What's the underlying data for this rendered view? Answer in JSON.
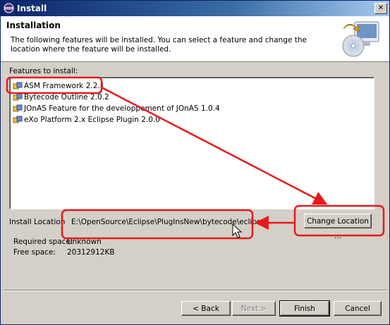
{
  "window": {
    "title": "Install"
  },
  "header": {
    "heading": "Installation",
    "description": "The following features will be installed. You can select a feature and change the location where the feature will be installed."
  },
  "features": {
    "label": "Features to install:",
    "items": [
      {
        "label": "ASM Framework 2.2.1",
        "icon": "feature-plug-icon"
      },
      {
        "label": "Bytecode Outline 2.0.2",
        "icon": "feature-plug-icon"
      },
      {
        "label": "JOnAS Feature for the developpement of JOnAS 1.0.4",
        "icon": "feature-plug-icon"
      },
      {
        "label": "eXo Platform 2.x Eclipse Plugin 2.0.0",
        "icon": "feature-plug-icon"
      }
    ]
  },
  "install_location": {
    "label": "Install Location",
    "value": "E:\\OpenSource\\Eclipse\\PlugInsNew\\bytecode\\eclipse",
    "change_button": "Change Location ..."
  },
  "space": {
    "required_label": "Required space:",
    "required_value": "Unknown",
    "free_label": "Free space:",
    "free_value": "20312912KB"
  },
  "buttons": {
    "back": "< Back",
    "next": "Next >",
    "finish": "Finish",
    "cancel": "Cancel"
  },
  "annotation_color": "#e8191a"
}
